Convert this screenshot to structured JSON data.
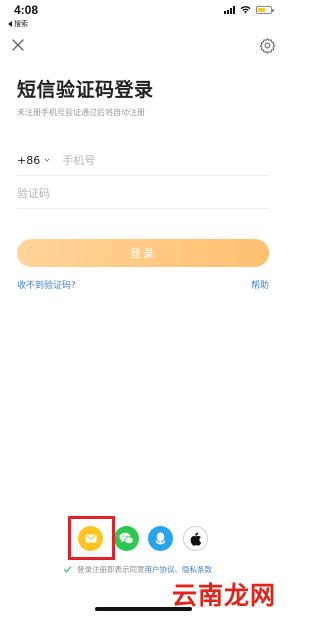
{
  "status_bar": {
    "time": "4:08",
    "back_app_label": "搜索",
    "battery_color": "#f7c325",
    "battery_level": 0.6
  },
  "header": {
    "close_icon": "close-icon",
    "settings_icon": "gear-icon"
  },
  "title": "短信验证码登录",
  "subtitle": "未注册手机号验证通过后将自动注册",
  "form": {
    "country_code": "+86",
    "phone_placeholder": "手机号",
    "code_placeholder": "验证码",
    "login_label": "登录"
  },
  "links": {
    "no_code": "收不到验证码?",
    "help": "帮助"
  },
  "third_party": [
    {
      "name": "sms-login",
      "icon": "envelope-icon",
      "color": "#ffc41f"
    },
    {
      "name": "wechat-login",
      "icon": "wechat-icon",
      "color": "#2dc84d"
    },
    {
      "name": "qq-login",
      "icon": "qq-icon",
      "color": "#2aa3ef"
    },
    {
      "name": "apple-login",
      "icon": "apple-icon",
      "color": "#111111"
    }
  ],
  "agreement": {
    "prefix": "登录注册即表示同意",
    "user_agreement": "用户协议",
    "separator": "、",
    "privacy_policy": "隐私条款"
  },
  "watermark": "云南龙网",
  "colors": {
    "accent_link": "#3f7fd6",
    "login_gradient_start": "#ffd49a",
    "login_gradient_end": "#ffc070",
    "highlight": "#e0202a"
  }
}
